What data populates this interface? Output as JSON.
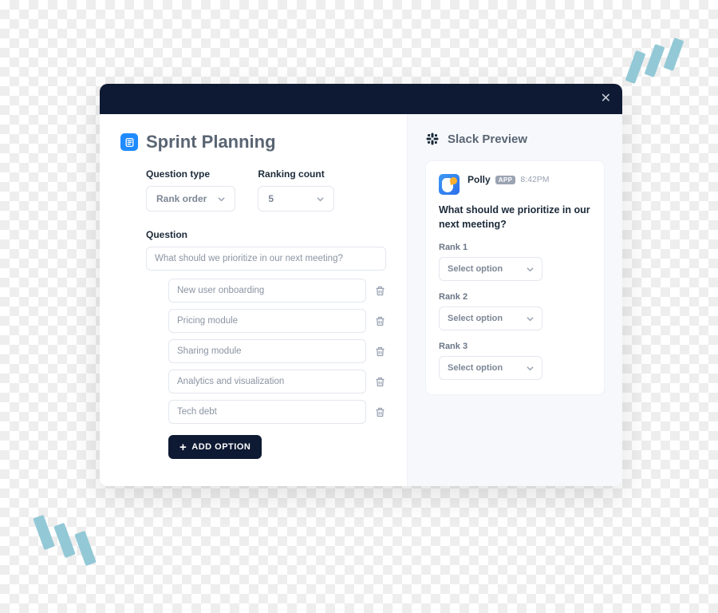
{
  "title": "Sprint Planning",
  "form": {
    "question_type_label": "Question type",
    "question_type_value": "Rank order",
    "ranking_count_label": "Ranking count",
    "ranking_count_value": "5",
    "question_label": "Question",
    "question_value": "What should we prioritize in our next meeting?",
    "options": [
      "New user onboarding",
      "Pricing module",
      "Sharing module",
      "Analytics and visualization",
      "Tech debt"
    ],
    "add_option_label": "ADD OPTION"
  },
  "preview": {
    "title": "Slack Preview",
    "sender": "Polly",
    "badge": "APP",
    "time": "8:42PM",
    "question": "What should we prioritize in our next meeting?",
    "ranks": [
      {
        "label": "Rank 1",
        "placeholder": "Select option"
      },
      {
        "label": "Rank 2",
        "placeholder": "Select option"
      },
      {
        "label": "Rank 3",
        "placeholder": "Select option"
      }
    ]
  }
}
